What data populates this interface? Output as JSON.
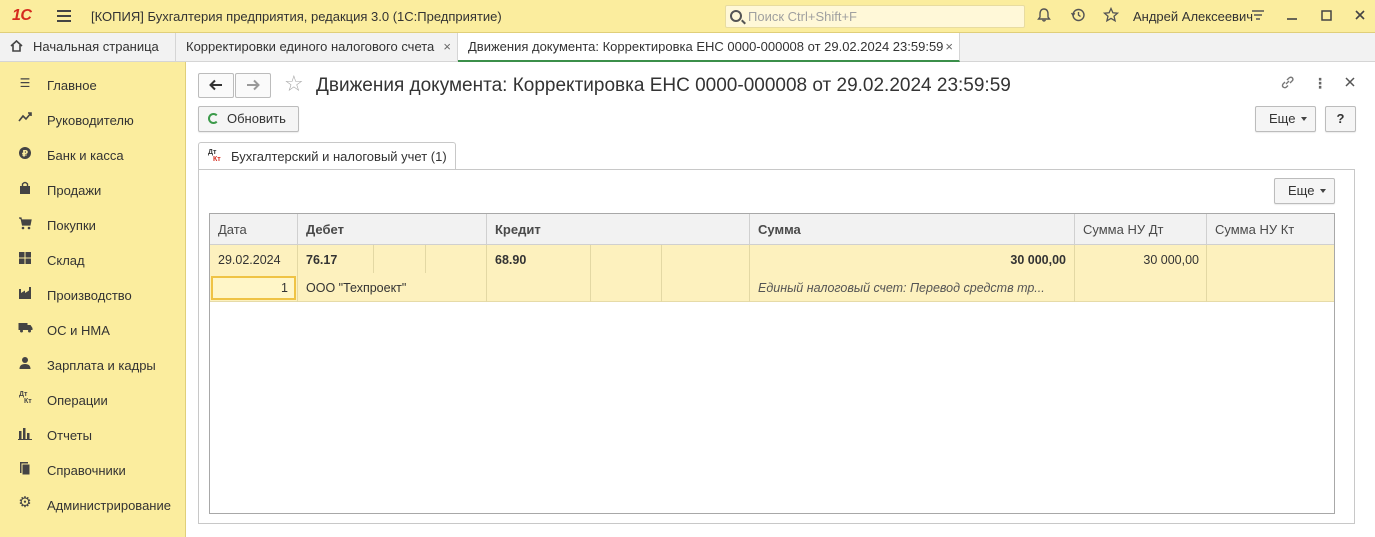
{
  "app": {
    "logo": "1С",
    "title": "[КОПИЯ] Бухгалтерия предприятия, редакция 3.0  (1С:Предприятие)",
    "search_placeholder": "Поиск Ctrl+Shift+F",
    "user": "Андрей Алексеевич",
    "accent_color": "#fbed9e"
  },
  "tabs": [
    {
      "label": "Начальная страница"
    },
    {
      "label": "Корректировки единого налогового счета",
      "close": "×"
    },
    {
      "label": "Движения документа: Корректировка ЕНС 0000-000008 от 29.02.2024 23:59:59",
      "close": "×",
      "active": true
    }
  ],
  "sidebar": {
    "items": [
      {
        "label": "Главное",
        "icon": "menu-lines-icon"
      },
      {
        "label": "Руководителю",
        "icon": "trend-icon"
      },
      {
        "label": "Банк и касса",
        "icon": "coin-icon"
      },
      {
        "label": "Продажи",
        "icon": "bag-icon"
      },
      {
        "label": "Покупки",
        "icon": "cart-icon"
      },
      {
        "label": "Склад",
        "icon": "warehouse-icon"
      },
      {
        "label": "Производство",
        "icon": "factory-icon"
      },
      {
        "label": "ОС и НМА",
        "icon": "truck-icon"
      },
      {
        "label": "Зарплата и кадры",
        "icon": "people-icon"
      },
      {
        "label": "Операции",
        "icon": "dt-kt-icon"
      },
      {
        "label": "Отчеты",
        "icon": "bar-chart-icon"
      },
      {
        "label": "Справочники",
        "icon": "books-icon"
      },
      {
        "label": "Администрирование",
        "icon": "gear-icon"
      }
    ]
  },
  "document": {
    "title": "Движения документа: Корректировка ЕНС 0000-000008 от 29.02.2024 23:59:59",
    "refresh_label": "Обновить",
    "more_label": "Еще",
    "help_label": "?",
    "form_tab_label": "Бухгалтерский и налоговый учет (1)",
    "dt_label": "Дт",
    "kt_label": "Кт",
    "table_more_label": "Еще"
  },
  "table": {
    "columns": [
      "Дата",
      "Дебет",
      "Кредит",
      "Сумма",
      "Сумма НУ Дт",
      "Сумма НУ Кт"
    ],
    "rows": [
      {
        "date": "29.02.2024",
        "debit": "76.17",
        "credit": "68.90",
        "amount": "30 000,00",
        "amount_nu_dt": "30 000,00",
        "amount_nu_kt": "",
        "line_no": "1",
        "debit_subconto": "ООО \"Техпроект\"",
        "content": "Единый налоговый счет: Перевод средств тр..."
      }
    ]
  }
}
